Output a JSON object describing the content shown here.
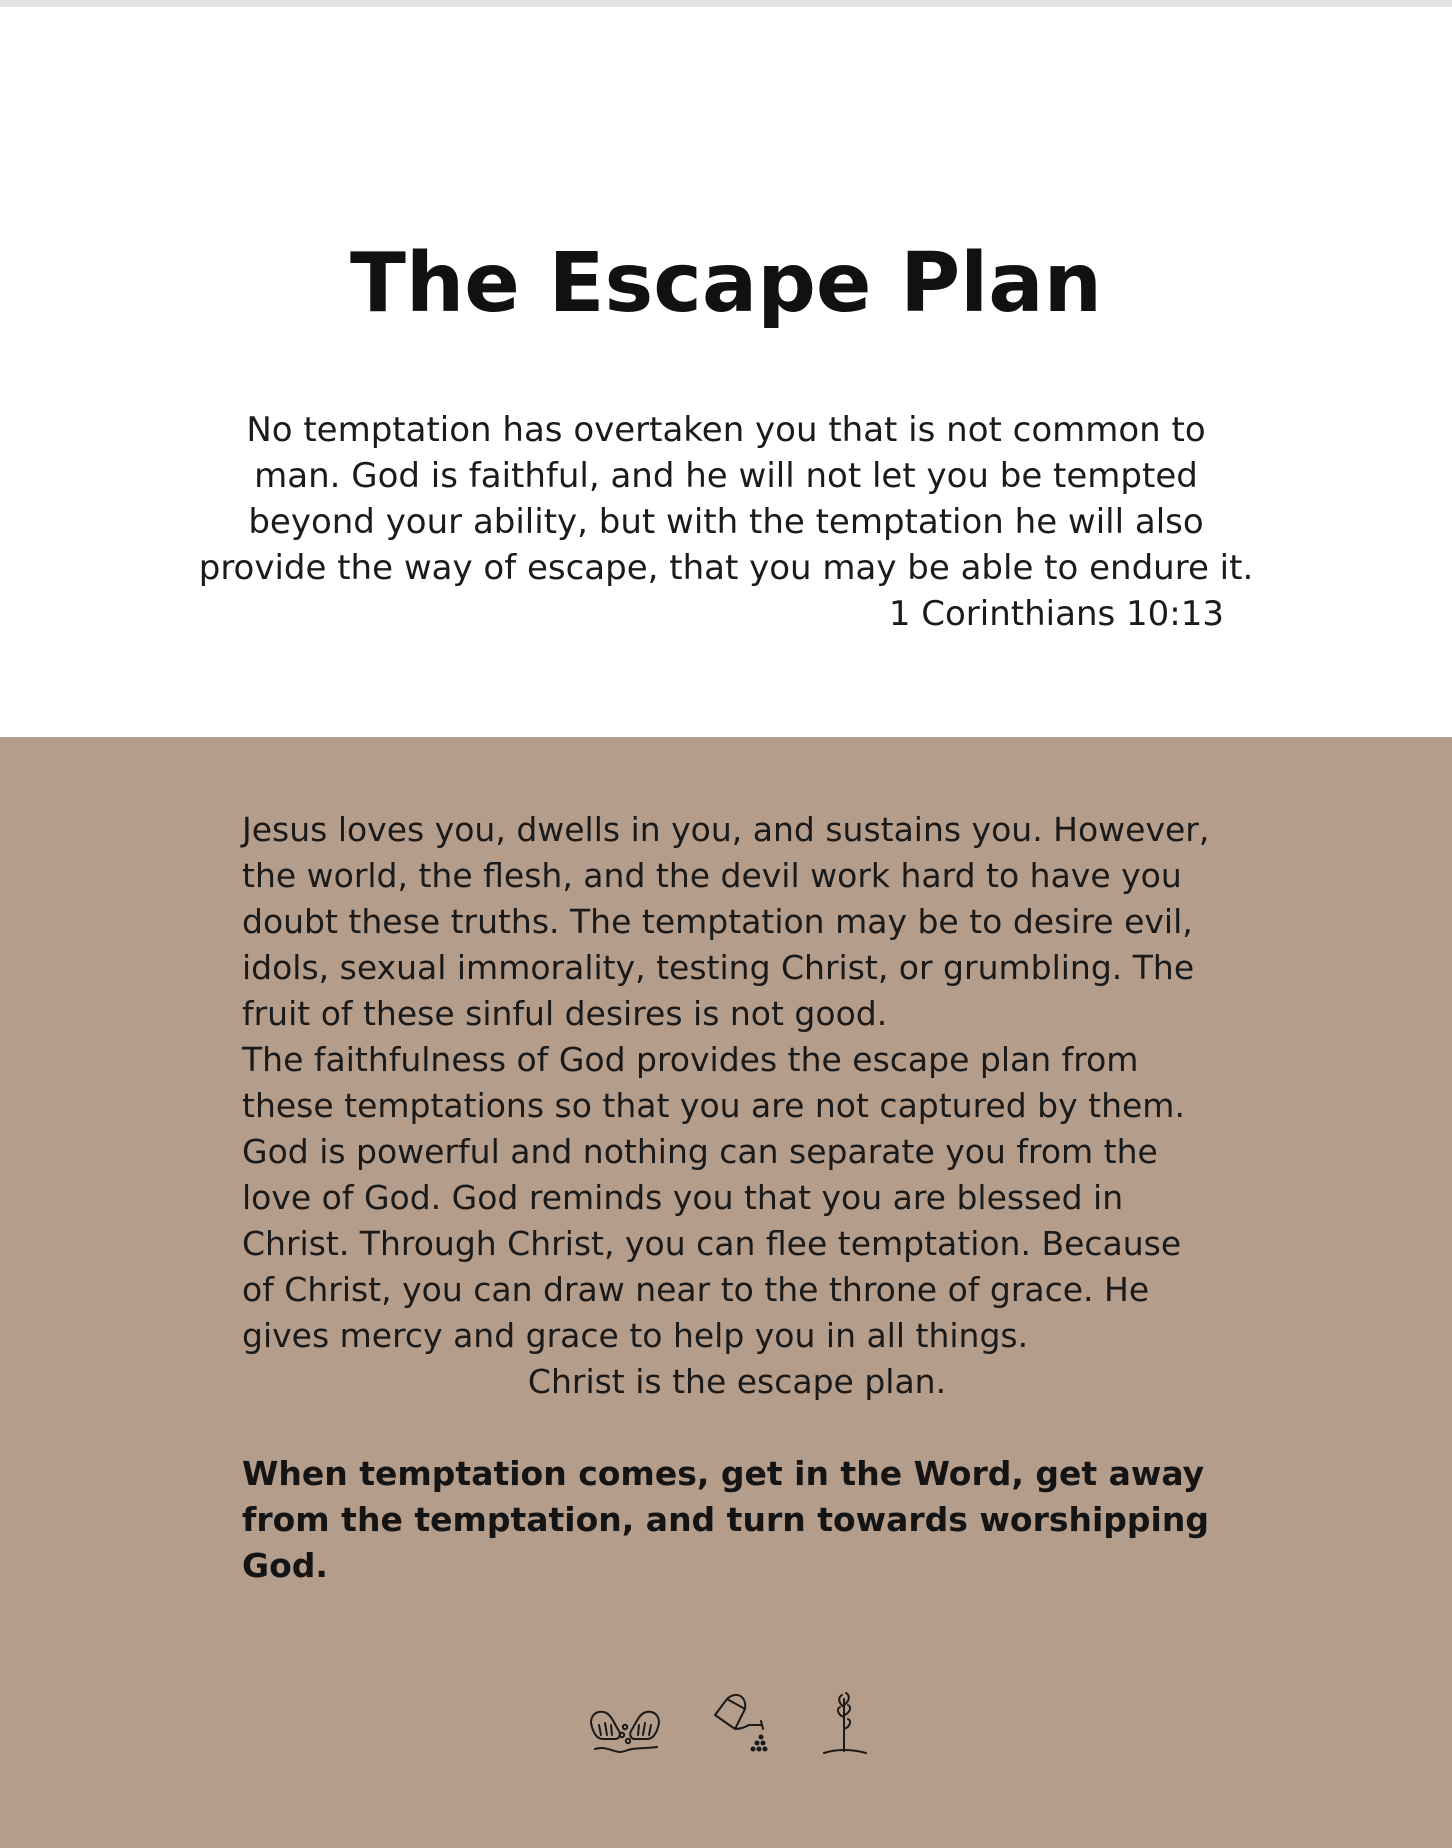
{
  "document": {
    "title": "The Escape Plan",
    "verse_lines": [
      "No temptation has overtaken you that is not common to",
      "man. God is faithful, and he will not let you be tempted",
      "beyond your ability, but with the temptation he will also",
      "provide the way of escape, that you may be able to endure it."
    ],
    "verse_reference": "1 Corinthians 10:13",
    "body_lines": [
      "Jesus loves you, dwells in you, and sustains you. However,",
      "the world, the flesh, and the devil work hard to have you",
      "doubt these truths. The temptation may be to desire evil,",
      "idols, sexual immorality, testing Christ, or grumbling. The",
      "fruit of these sinful desires is not good.",
      "The faithfulness of God provides the escape plan from",
      "these temptations so that you are not captured by them.",
      "God is powerful and nothing can separate you from the",
      "love of God. God reminds you that you are blessed in",
      "Christ. Through Christ, you can flee temptation. Because",
      "of Christ, you can draw near to the throne of grace. He",
      "gives mercy and grace to help you in all things."
    ],
    "closing_line": "Christ is the escape plan.",
    "callout_lines": [
      "When temptation comes, get in the Word, get away",
      "from the temptation, and turn towards worshipping",
      "God."
    ]
  },
  "icons": [
    "hands-sowing-seeds-icon",
    "watering-can-icon",
    "sprout-icon"
  ],
  "colors": {
    "top_background": "#ffffff",
    "content_background": "#b59d8b",
    "text": "#1a1a1a",
    "top_bar": "#e3e3e3"
  }
}
